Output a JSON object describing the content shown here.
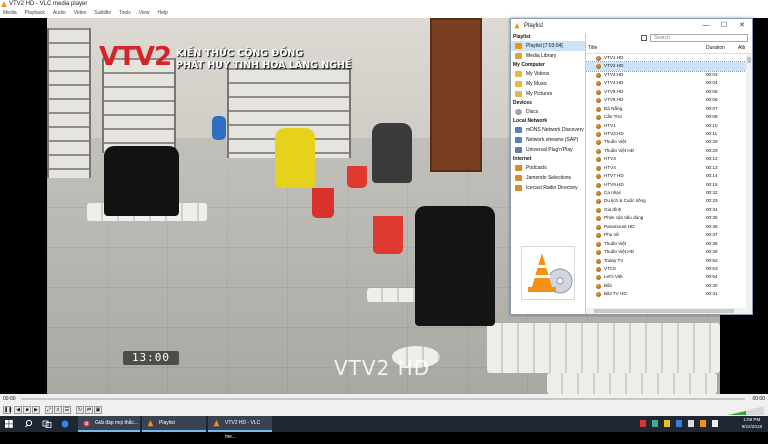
{
  "window": {
    "title": "VTV2 HD - VLC media player"
  },
  "menu": [
    "Media",
    "Playback",
    "Audio",
    "Video",
    "Subtitle",
    "Tools",
    "View",
    "Help"
  ],
  "video": {
    "channel_logo": "VTV2",
    "caption_line1": "KIẾN THỨC CỘNG ĐỒNG",
    "caption_line2": "PHÁT HUY TINH HOA LÀNG NGHỀ",
    "clock": "13:00",
    "watermark": "VTV2 HD"
  },
  "playlist": {
    "title": "Playlist",
    "window_buttons": {
      "minimize": "—",
      "maximize": "☐",
      "close": "✕"
    },
    "sidebar": {
      "playlist_header": "Playlist",
      "playlist_items": [
        {
          "label": "Playlist [7:03:04]",
          "icon": "playlist-icon",
          "selected": true
        },
        {
          "label": "Media Library",
          "icon": "media-library-icon"
        }
      ],
      "my_computer_header": "My Computer",
      "my_computer_items": [
        {
          "label": "My Videos",
          "icon": "videos-folder-icon"
        },
        {
          "label": "My Music",
          "icon": "music-folder-icon"
        },
        {
          "label": "My Pictures",
          "icon": "pictures-folder-icon"
        }
      ],
      "devices_header": "Devices",
      "devices_items": [
        {
          "label": "Discs",
          "icon": "disc-icon"
        }
      ],
      "lan_header": "Local Network",
      "lan_items": [
        {
          "label": "mDNS Network Discovery",
          "icon": "network-icon"
        },
        {
          "label": "Network streams (SAP)",
          "icon": "network-icon"
        },
        {
          "label": "Universal Plug'n'Play",
          "icon": "network-icon"
        }
      ],
      "internet_header": "Internet",
      "internet_items": [
        {
          "label": "Podcasts",
          "icon": "podcast-icon"
        },
        {
          "label": "Jamendo Selections",
          "icon": "jamendo-icon"
        },
        {
          "label": "Icecast Radio Directory",
          "icon": "radio-icon"
        }
      ]
    },
    "search_placeholder": "Search",
    "columns": {
      "title": "Title",
      "duration": "Duration",
      "album": "Alb"
    },
    "rows": [
      {
        "title": "VTV1 HD",
        "duration": ""
      },
      {
        "title": "VTV2 HD",
        "duration": "",
        "selected": true
      },
      {
        "title": "VTV3 HD",
        "duration": "00:03"
      },
      {
        "title": "VTV4 HD",
        "duration": "00:04"
      },
      {
        "title": "VTV5 HD",
        "duration": "00:05"
      },
      {
        "title": "VTV6 HD",
        "duration": "00:06"
      },
      {
        "title": "Đà Nẵng",
        "duration": "00:07"
      },
      {
        "title": "Cần Thơ",
        "duration": "00:08"
      },
      {
        "title": "HTV1",
        "duration": "00:10"
      },
      {
        "title": "HTV2 HD",
        "duration": "00:11"
      },
      {
        "title": "Thuần Việt",
        "duration": "00:28"
      },
      {
        "title": "Thuần Việt HD",
        "duration": "00:29"
      },
      {
        "title": "HTV3",
        "duration": "00:12"
      },
      {
        "title": "HTV4",
        "duration": "00:13"
      },
      {
        "title": "HTV7 HD",
        "duration": "00:14"
      },
      {
        "title": "HTV9 HD",
        "duration": "00:15"
      },
      {
        "title": "Ca nhạc",
        "duration": "00:32"
      },
      {
        "title": "Du lịch & Cuộc sống",
        "duration": "00:33"
      },
      {
        "title": "Gia đình",
        "duration": "00:34"
      },
      {
        "title": "Phim cận tiêu dùng",
        "duration": "00:35"
      },
      {
        "title": "Paramount HD",
        "duration": "00:36"
      },
      {
        "title": "Phụ nữ",
        "duration": "00:37"
      },
      {
        "title": "Thuần Việt",
        "duration": "00:38"
      },
      {
        "title": "Thuần Việt HD",
        "duration": "00:39"
      },
      {
        "title": "Today TV",
        "duration": "00:52"
      },
      {
        "title": "VTC6",
        "duration": "00:53"
      },
      {
        "title": "Let's Việt",
        "duration": "00:54"
      },
      {
        "title": "Bibi",
        "duration": "00:30"
      },
      {
        "title": "Bibi TV HD",
        "duration": "00:31"
      }
    ]
  },
  "controls": {
    "elapsed": "00:00",
    "total": "00:00",
    "volume_level": 0.5
  },
  "taskbar": {
    "tasks": [
      {
        "label": "Giải đáp mọi thắc...",
        "icon": "chrome-icon"
      },
      {
        "label": "Playlist",
        "icon": "vlc-cone-icon"
      },
      {
        "label": "VTV2 HD - VLC me...",
        "icon": "vlc-cone-icon"
      }
    ],
    "time": "1:08 PM",
    "date": "9/22/2018"
  },
  "colors": {
    "vlc_orange": "#f29112",
    "selection": "#cde3f7",
    "taskbar": "#1f2733",
    "vtv_red": "#d4242a",
    "vtv_blue": "#1b6fbd"
  }
}
